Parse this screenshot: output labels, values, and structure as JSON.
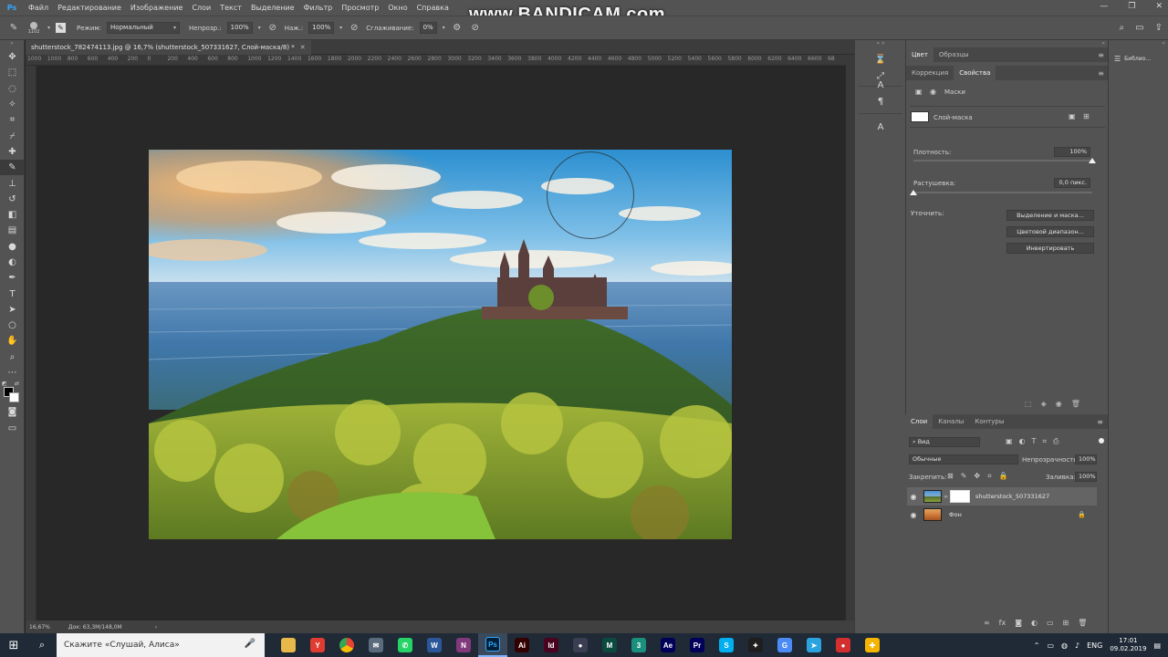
{
  "menubar": {
    "logo": "Ps",
    "items": [
      "Файл",
      "Редактирование",
      "Изображение",
      "Слои",
      "Текст",
      "Выделение",
      "Фильтр",
      "Просмотр",
      "Окно",
      "Справка"
    ],
    "window_controls": [
      "—",
      "❐",
      "✕"
    ]
  },
  "watermark": "www.BANDICAM.com",
  "options_bar": {
    "brush_size": "1102",
    "mode_label": "Режим:",
    "mode_value": "Нормальный",
    "opacity_label": "Непрозр.:",
    "opacity_value": "100%",
    "flow_label": "Наж.:",
    "flow_value": "100%",
    "smoothing_label": "Сглаживание:",
    "smoothing_value": "0%"
  },
  "document": {
    "tab_title": "shutterstock_782474113.jpg @ 16,7% (shutterstock_507331627, Слой-маска/8) *",
    "tab_close": "✕",
    "ruler_ticks": [
      "1000",
      "1000",
      "800",
      "600",
      "400",
      "200",
      "0",
      "200",
      "400",
      "600",
      "800",
      "1000",
      "1200",
      "1400",
      "1600",
      "1800",
      "2000",
      "2200",
      "2400",
      "2600",
      "2800",
      "3000",
      "3200",
      "3400",
      "3600",
      "3800",
      "4000",
      "4200",
      "4400",
      "4600",
      "4800",
      "5000",
      "5200",
      "5400",
      "5600",
      "5800",
      "6000",
      "6200",
      "6400",
      "6600",
      "68"
    ],
    "zoom": "16,67%",
    "doc_size": "Док: 63,3M/148,0M"
  },
  "properties_panel": {
    "tabs_top": [
      "Цвет",
      "Образцы"
    ],
    "tabs": [
      "Коррекция",
      "Свойства"
    ],
    "section_title": "Маски",
    "mask_name": "Слой-маска",
    "density_label": "Плотность:",
    "density_value": "100%",
    "density_level": 1.0,
    "feather_label": "Растушевка:",
    "feather_value": "0,0 пикс.",
    "feather_level": 0.0,
    "refine_label": "Уточнить:",
    "buttons": [
      "Выделение и маска...",
      "Цветовой диапазон...",
      "Инвертировать"
    ]
  },
  "layers_panel": {
    "tabs": [
      "Слои",
      "Каналы",
      "Контуры"
    ],
    "filter_value": "Вид",
    "blend_mode": "Обычные",
    "opacity_label": "Непрозрачность:",
    "opacity_value": "100%",
    "lock_label": "Закрепить:",
    "fill_label": "Заливка:",
    "fill_value": "100%",
    "layers": [
      {
        "name": "shutterstock_507331627",
        "selected": true,
        "has_mask": true
      },
      {
        "name": "Фон",
        "selected": false,
        "has_mask": false,
        "locked": true
      }
    ]
  },
  "far_right": {
    "libraries_label": "Библио..."
  },
  "taskbar": {
    "search_placeholder": "Скажите «Слушай, Алиса»",
    "apps": [
      {
        "name": "explorer",
        "label": "",
        "color": "#e8b84a"
      },
      {
        "name": "yandex",
        "label": "Y",
        "color": "#e03c31"
      },
      {
        "name": "chrome",
        "label": "",
        "color": "#3aa757"
      },
      {
        "name": "mail",
        "label": "✉",
        "color": "#5b6b7d"
      },
      {
        "name": "whatsapp",
        "label": "✆",
        "color": "#25d366"
      },
      {
        "name": "word",
        "label": "W",
        "color": "#2b579a"
      },
      {
        "name": "onenote",
        "label": "N",
        "color": "#80397b"
      },
      {
        "name": "photoshop",
        "label": "Ps",
        "color": "#001e36"
      },
      {
        "name": "illustrator",
        "label": "Ai",
        "color": "#330000"
      },
      {
        "name": "indesign",
        "label": "Id",
        "color": "#49021f"
      },
      {
        "name": "obs",
        "label": "●",
        "color": "#3b3e52"
      },
      {
        "name": "muse",
        "label": "M",
        "color": "#0a4a3f"
      },
      {
        "name": "app3",
        "label": "3",
        "color": "#1a8f7d"
      },
      {
        "name": "aftereffects",
        "label": "Ae",
        "color": "#00005b"
      },
      {
        "name": "premiere",
        "label": "Pr",
        "color": "#00005b"
      },
      {
        "name": "skype",
        "label": "S",
        "color": "#00aff0"
      },
      {
        "name": "figma",
        "label": "✦",
        "color": "#1e1e1e"
      },
      {
        "name": "browser",
        "label": "G",
        "color": "#4c8bf5"
      },
      {
        "name": "telegram",
        "label": "➤",
        "color": "#2aa3e0"
      },
      {
        "name": "bandicam",
        "label": "●",
        "color": "#d32f2f"
      },
      {
        "name": "app-active",
        "label": "✚",
        "color": "#f4b400"
      }
    ],
    "tray_lang": "ENG",
    "time": "17:01",
    "date": "09.02.2019"
  }
}
